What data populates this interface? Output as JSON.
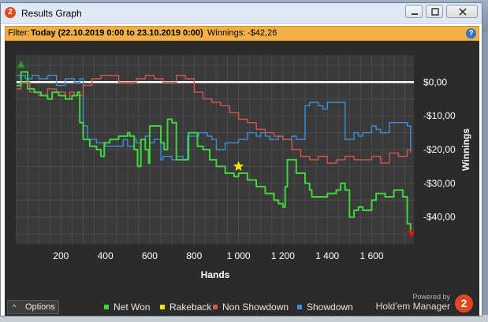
{
  "window": {
    "title": "Results Graph",
    "app_icon_glyph": "2"
  },
  "filter": {
    "label": "Filter:",
    "period": "Today (22.10.2019 0:00 to 23.10.2019 0:00)",
    "winnings_label": "Winnings:",
    "winnings_value": "-$42,26",
    "help_glyph": "?"
  },
  "options": {
    "label": "Options",
    "chevron": "^"
  },
  "branding": {
    "powered_by": "Powered by",
    "product": "Hold'em Manager",
    "logo_glyph": "2"
  },
  "colors": {
    "net_won": "#3dd63d",
    "rakeback": "#f2e600",
    "non_showdown": "#d9534f",
    "showdown": "#3b8fd9",
    "zero_line": "#ffffff",
    "panel_bg": "#2b2b2b",
    "plot_bg": "#3a3a3a",
    "filter_bg": "#f2b047"
  },
  "chart_data": {
    "type": "line",
    "title": "",
    "xlabel": "Hands",
    "ylabel": "Winnings",
    "xlim": [
      0,
      1790
    ],
    "ylim": [
      -48,
      8
    ],
    "xticks": [
      200,
      400,
      600,
      800,
      1000,
      1200,
      1400,
      1600
    ],
    "xtick_labels": [
      "200",
      "400",
      "600",
      "800",
      "1 000",
      "1 200",
      "1 400",
      "1 600"
    ],
    "yticks": [
      0,
      -10,
      -20,
      -30,
      -40
    ],
    "ytick_labels": [
      "$0,00",
      "-$10,00",
      "-$20,00",
      "-$30,00",
      "-$40,00"
    ],
    "grid": true,
    "legend_position": "bottom",
    "start_marker": {
      "x": 20,
      "y": 5
    },
    "end_marker": {
      "x": 1775,
      "y": -44.5
    },
    "series": [
      {
        "name": "Net Won",
        "x": [
          0,
          20,
          50,
          80,
          110,
          140,
          160,
          190,
          220,
          250,
          270,
          275,
          285,
          300,
          330,
          360,
          380,
          395,
          420,
          460,
          500,
          510,
          530,
          545,
          560,
          580,
          595,
          600,
          620,
          650,
          665,
          680,
          700,
          720,
          760,
          775,
          800,
          815,
          840,
          870,
          900,
          940,
          980,
          1000,
          1040,
          1080,
          1120,
          1160,
          1180,
          1200,
          1210,
          1220,
          1260,
          1300,
          1320,
          1330,
          1360,
          1400,
          1440,
          1460,
          1480,
          1500,
          1520,
          1540,
          1560,
          1600,
          1620,
          1640,
          1660,
          1700,
          1740,
          1760,
          1775
        ],
        "y": [
          -1,
          3,
          -2,
          -3,
          -4,
          -5,
          -3,
          -4,
          -5,
          -4,
          -4,
          -3,
          -12,
          -17,
          -19,
          -20,
          -22,
          -18,
          -17,
          -16,
          -15,
          -16,
          -20,
          -25,
          -17,
          -20,
          -24,
          -13,
          -13,
          -18,
          -20,
          -11,
          -12,
          -23,
          -23,
          -15,
          -15,
          -19,
          -20,
          -23,
          -25,
          -27,
          -28,
          -27,
          -29,
          -31,
          -33,
          -35,
          -36,
          -37,
          -31,
          -23,
          -27,
          -30,
          -32,
          -34,
          -34,
          -33,
          -32,
          -30,
          -32,
          -40,
          -38,
          -37,
          -38,
          -35,
          -33,
          -33,
          -34,
          -32,
          -34,
          -42,
          -44.5
        ]
      },
      {
        "name": "Rakeback",
        "x": [
          1000
        ],
        "y": [
          -25
        ]
      },
      {
        "name": "Non Showdown",
        "x": [
          0,
          20,
          60,
          100,
          140,
          180,
          220,
          240,
          260,
          300,
          340,
          380,
          420,
          460,
          500,
          540,
          580,
          620,
          660,
          700,
          720,
          760,
          800,
          840,
          880,
          920,
          960,
          1000,
          1040,
          1080,
          1120,
          1160,
          1200,
          1240,
          1280,
          1320,
          1360,
          1400,
          1440,
          1480,
          1520,
          1560,
          1600,
          1640,
          1680,
          1720,
          1760,
          1775
        ],
        "y": [
          -2,
          0,
          -3,
          -4,
          -2,
          -3,
          -5,
          -3,
          -4,
          -1,
          1,
          2,
          2,
          0,
          0,
          1,
          2,
          1,
          0,
          0,
          2,
          1,
          -3,
          -5,
          -6,
          -7,
          -9,
          -11,
          -12,
          -14,
          -15,
          -16,
          -17,
          -20,
          -22,
          -23,
          -22,
          -24,
          -23,
          -22,
          -23,
          -23,
          -22,
          -24,
          -21,
          -22,
          -20,
          -21
        ]
      },
      {
        "name": "Showdown",
        "x": [
          0,
          20,
          40,
          70,
          100,
          140,
          170,
          180,
          220,
          260,
          280,
          285,
          300,
          320,
          360,
          400,
          440,
          480,
          500,
          530,
          540,
          560,
          580,
          600,
          620,
          650,
          660,
          700,
          720,
          750,
          770,
          800,
          820,
          860,
          880,
          900,
          940,
          980,
          1000,
          1040,
          1080,
          1100,
          1120,
          1140,
          1180,
          1200,
          1240,
          1260,
          1300,
          1320,
          1340,
          1360,
          1380,
          1400,
          1440,
          1480,
          1520,
          1540,
          1560,
          1600,
          1620,
          1640,
          1680,
          1720,
          1760,
          1775
        ],
        "y": [
          2,
          2,
          1,
          2,
          1,
          2,
          2,
          -1,
          1,
          0,
          0,
          1,
          -13,
          -17,
          -18,
          -19,
          -19,
          -17,
          -19,
          -17,
          -18,
          -17,
          -16,
          -18,
          -17,
          -23,
          -22,
          -23,
          -22,
          -23,
          -16,
          -16,
          -15,
          -16,
          -17,
          -20,
          -18,
          -18,
          -17,
          -15,
          -16,
          -15,
          -16,
          -17,
          -16,
          -17,
          -16,
          -17,
          -7,
          -6,
          -6,
          -7,
          -8,
          -6,
          -6,
          -17,
          -15,
          -16,
          -15,
          -13,
          -14,
          -15,
          -12,
          -12,
          -13,
          -20
        ]
      }
    ]
  }
}
